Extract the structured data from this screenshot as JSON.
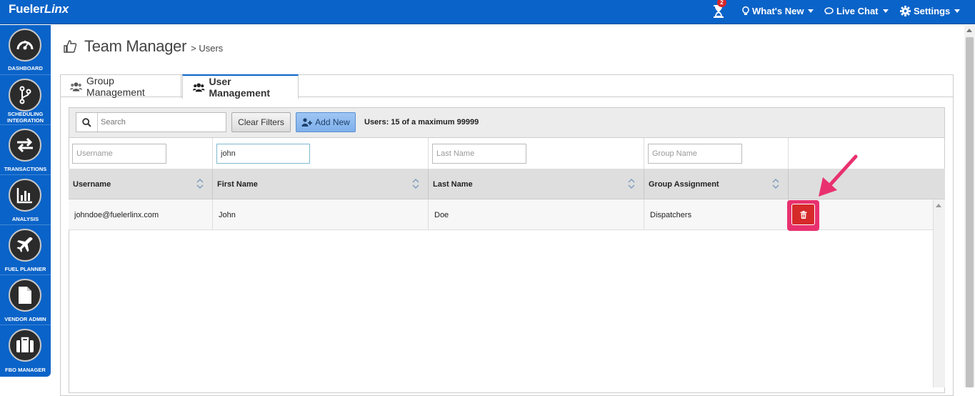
{
  "app": {
    "logo_main": "Fueler",
    "logo_italic": "Linx"
  },
  "topbar": {
    "notification_count": "2",
    "whats_new": "What's New",
    "live_chat": "Live Chat",
    "settings": "Settings"
  },
  "sidebar": {
    "items": [
      {
        "label": "DASHBOARD",
        "icon": "dashboard-icon"
      },
      {
        "label": "SCHEDULING INTEGRATION",
        "icon": "branch-icon"
      },
      {
        "label": "TRANSACTIONS",
        "icon": "transfer-icon"
      },
      {
        "label": "ANALYSIS",
        "icon": "bar-chart-icon"
      },
      {
        "label": "FUEL PLANNER",
        "icon": "plane-icon"
      },
      {
        "label": "VENDOR ADMIN",
        "icon": "document-icon"
      },
      {
        "label": "FBO MANAGER",
        "icon": "briefcase-icon"
      }
    ]
  },
  "page": {
    "title": "Team Manager",
    "breadcrumb": "> Users"
  },
  "tabs": [
    {
      "label": "Group Management",
      "active": false
    },
    {
      "label": "User Management",
      "active": true
    }
  ],
  "toolbar": {
    "search_placeholder": "Search",
    "clear_filters": "Clear Filters",
    "add_new": "Add New",
    "users_count": "Users: 15 of a maximum 99999"
  },
  "filters": {
    "username_placeholder": "Username",
    "first_name_value": "john",
    "last_name_placeholder": "Last Name",
    "group_name_placeholder": "Group Name"
  },
  "table": {
    "columns": [
      "Username",
      "First Name",
      "Last Name",
      "Group Assignment"
    ],
    "rows": [
      {
        "username": "johndoe@fuelerlinx.com",
        "first_name": "John",
        "last_name": "Doe",
        "group": "Dispatchers"
      }
    ]
  },
  "colors": {
    "brand_blue": "#0a63c8",
    "delete_red": "#d62a2a",
    "highlight_pink": "#e8316e"
  }
}
